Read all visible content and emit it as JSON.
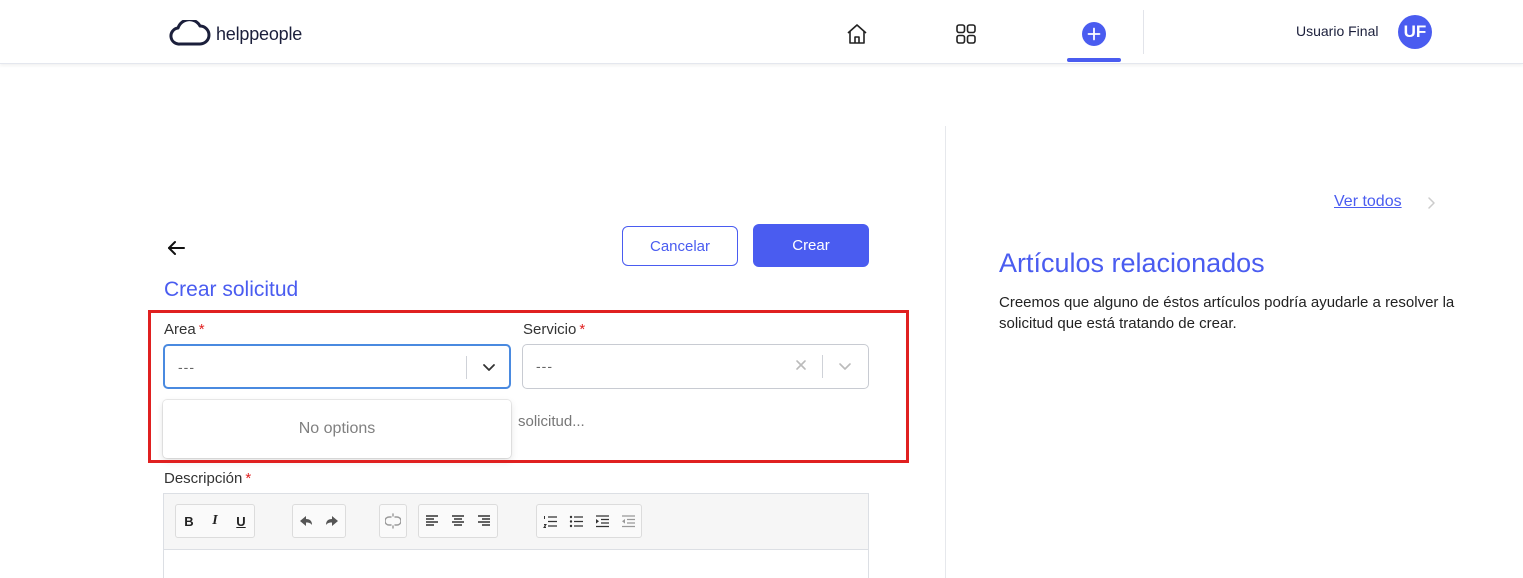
{
  "header": {
    "logo_text": "helppeople",
    "user_name": "Usuario Final",
    "avatar_initials": "UF",
    "accent_color": "#4a5cf0"
  },
  "form": {
    "title": "Crear solicitud",
    "cancel_label": "Cancelar",
    "create_label": "Crear",
    "area": {
      "label": "Area",
      "value": "---"
    },
    "service": {
      "label": "Servicio",
      "value": "---"
    },
    "dropdown_empty": "No options",
    "obscured_text": "solicitud...",
    "description_label": "Descripción",
    "required_mark": "*",
    "toolbar": {
      "bold": "B",
      "italic": "I",
      "underline": "U"
    }
  },
  "related": {
    "see_all": "Ver todos",
    "title": "Artículos relacionados",
    "text": "Creemos que alguno de éstos artículos podría ayudarle a resolver la solicitud que está tratando de crear."
  }
}
